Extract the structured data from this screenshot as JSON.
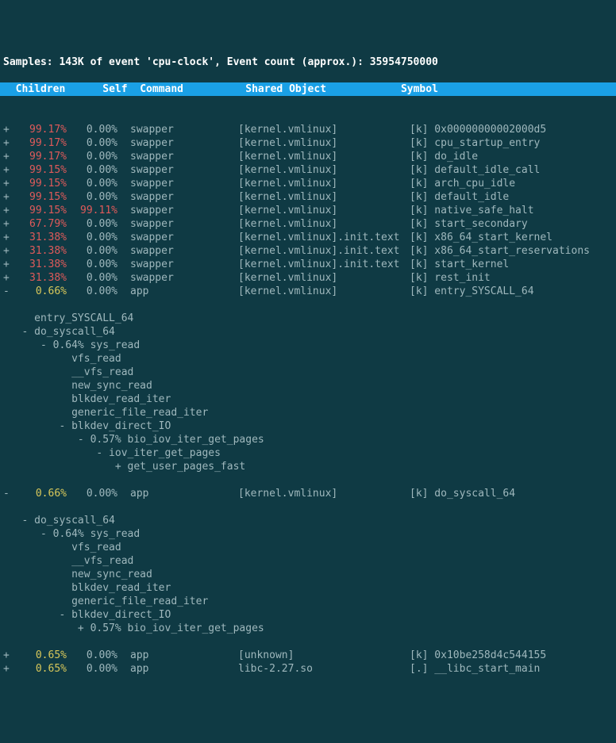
{
  "title": "Samples: 143K of event 'cpu-clock', Event count (approx.): 35954750000",
  "header": {
    "children": "  Children",
    "self": "      Self",
    "command": "  Command",
    "shared_object": "          Shared Object",
    "symbol": "            Symbol"
  },
  "rows": [
    {
      "sign": "+",
      "children": "99.17%",
      "self": "0.00%",
      "cmd": "swapper",
      "obj": "[kernel.vmlinux]",
      "sym": "[k] 0x00000000002000d5",
      "cls": "red"
    },
    {
      "sign": "+",
      "children": "99.17%",
      "self": "0.00%",
      "cmd": "swapper",
      "obj": "[kernel.vmlinux]",
      "sym": "[k] cpu_startup_entry",
      "cls": "red"
    },
    {
      "sign": "+",
      "children": "99.17%",
      "self": "0.00%",
      "cmd": "swapper",
      "obj": "[kernel.vmlinux]",
      "sym": "[k] do_idle",
      "cls": "red"
    },
    {
      "sign": "+",
      "children": "99.15%",
      "self": "0.00%",
      "cmd": "swapper",
      "obj": "[kernel.vmlinux]",
      "sym": "[k] default_idle_call",
      "cls": "red"
    },
    {
      "sign": "+",
      "children": "99.15%",
      "self": "0.00%",
      "cmd": "swapper",
      "obj": "[kernel.vmlinux]",
      "sym": "[k] arch_cpu_idle",
      "cls": "red"
    },
    {
      "sign": "+",
      "children": "99.15%",
      "self": "0.00%",
      "cmd": "swapper",
      "obj": "[kernel.vmlinux]",
      "sym": "[k] default_idle",
      "cls": "red"
    },
    {
      "sign": "+",
      "children": "99.15%",
      "self": "99.11%",
      "cmd": "swapper",
      "obj": "[kernel.vmlinux]",
      "sym": "[k] native_safe_halt",
      "cls": "red",
      "selfcls": "red"
    },
    {
      "sign": "+",
      "children": "67.79%",
      "self": "0.00%",
      "cmd": "swapper",
      "obj": "[kernel.vmlinux]",
      "sym": "[k] start_secondary",
      "cls": "red"
    },
    {
      "sign": "+",
      "children": "31.38%",
      "self": "0.00%",
      "cmd": "swapper",
      "obj": "[kernel.vmlinux].init.text",
      "sym": "[k] x86_64_start_kernel",
      "cls": "red"
    },
    {
      "sign": "+",
      "children": "31.38%",
      "self": "0.00%",
      "cmd": "swapper",
      "obj": "[kernel.vmlinux].init.text",
      "sym": "[k] x86_64_start_reservations",
      "cls": "red"
    },
    {
      "sign": "+",
      "children": "31.38%",
      "self": "0.00%",
      "cmd": "swapper",
      "obj": "[kernel.vmlinux].init.text",
      "sym": "[k] start_kernel",
      "cls": "red"
    },
    {
      "sign": "+",
      "children": "31.38%",
      "self": "0.00%",
      "cmd": "swapper",
      "obj": "[kernel.vmlinux]",
      "sym": "[k] rest_init",
      "cls": "red"
    },
    {
      "sign": "-",
      "children": "0.66%",
      "self": "0.00%",
      "cmd": "app",
      "obj": "[kernel.vmlinux]",
      "sym": "[k] entry_SYSCALL_64",
      "cls": "yellow"
    }
  ],
  "tree1": [
    "     entry_SYSCALL_64",
    "   - do_syscall_64",
    "      - 0.64% sys_read",
    "           vfs_read",
    "           __vfs_read",
    "           new_sync_read",
    "           blkdev_read_iter",
    "           generic_file_read_iter",
    "         - blkdev_direct_IO",
    "            - 0.57% bio_iov_iter_get_pages",
    "               - iov_iter_get_pages",
    "                  + get_user_pages_fast"
  ],
  "row_mid": {
    "sign": "-",
    "children": "0.66%",
    "self": "0.00%",
    "cmd": "app",
    "obj": "[kernel.vmlinux]",
    "sym": "[k] do_syscall_64",
    "cls": "yellow"
  },
  "tree2": [
    "   - do_syscall_64",
    "      - 0.64% sys_read",
    "           vfs_read",
    "           __vfs_read",
    "           new_sync_read",
    "           blkdev_read_iter",
    "           generic_file_read_iter",
    "         - blkdev_direct_IO",
    "            + 0.57% bio_iov_iter_get_pages"
  ],
  "rows_tail": [
    {
      "sign": "+",
      "children": "0.65%",
      "self": "0.00%",
      "cmd": "app",
      "obj": "[unknown]",
      "sym": "[k] 0x10be258d4c544155",
      "cls": "yellow"
    },
    {
      "sign": "+",
      "children": "0.65%",
      "self": "0.00%",
      "cmd": "app",
      "obj": "libc-2.27.so",
      "sym": "[.] __libc_start_main",
      "cls": "yellow"
    }
  ]
}
